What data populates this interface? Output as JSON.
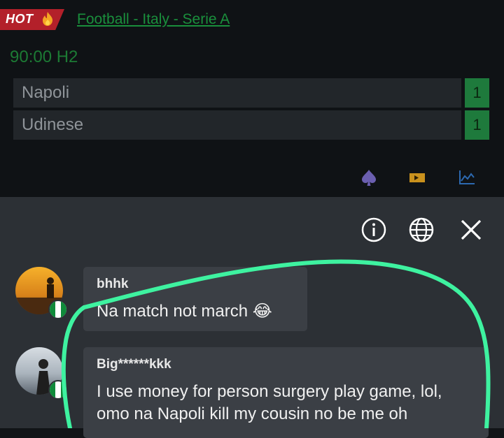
{
  "header": {
    "hot_label": "HOT",
    "league": "Football - Italy - Serie A",
    "match_time": "90:00 H2"
  },
  "teams": [
    {
      "name": "Napoli",
      "score": "1"
    },
    {
      "name": "Udinese",
      "score": "1"
    }
  ],
  "toolbar_icons": [
    "spade-icon",
    "ticket-icon",
    "stats-chart-icon"
  ],
  "chat": {
    "header_icons": [
      "info-icon",
      "globe-icon",
      "close-icon"
    ],
    "messages": [
      {
        "user": "bhhk",
        "text": "Na match not march 😂"
      },
      {
        "user": "Big******kkk",
        "text": "I use money for person surgery play game, lol, omo na Napoli kill my cousin no be me oh"
      }
    ]
  },
  "colors": {
    "accent_green": "#1a8f3c",
    "hot_red": "#b3202a",
    "score_green": "#1e7a3c",
    "annotation": "#3ef2a0"
  }
}
